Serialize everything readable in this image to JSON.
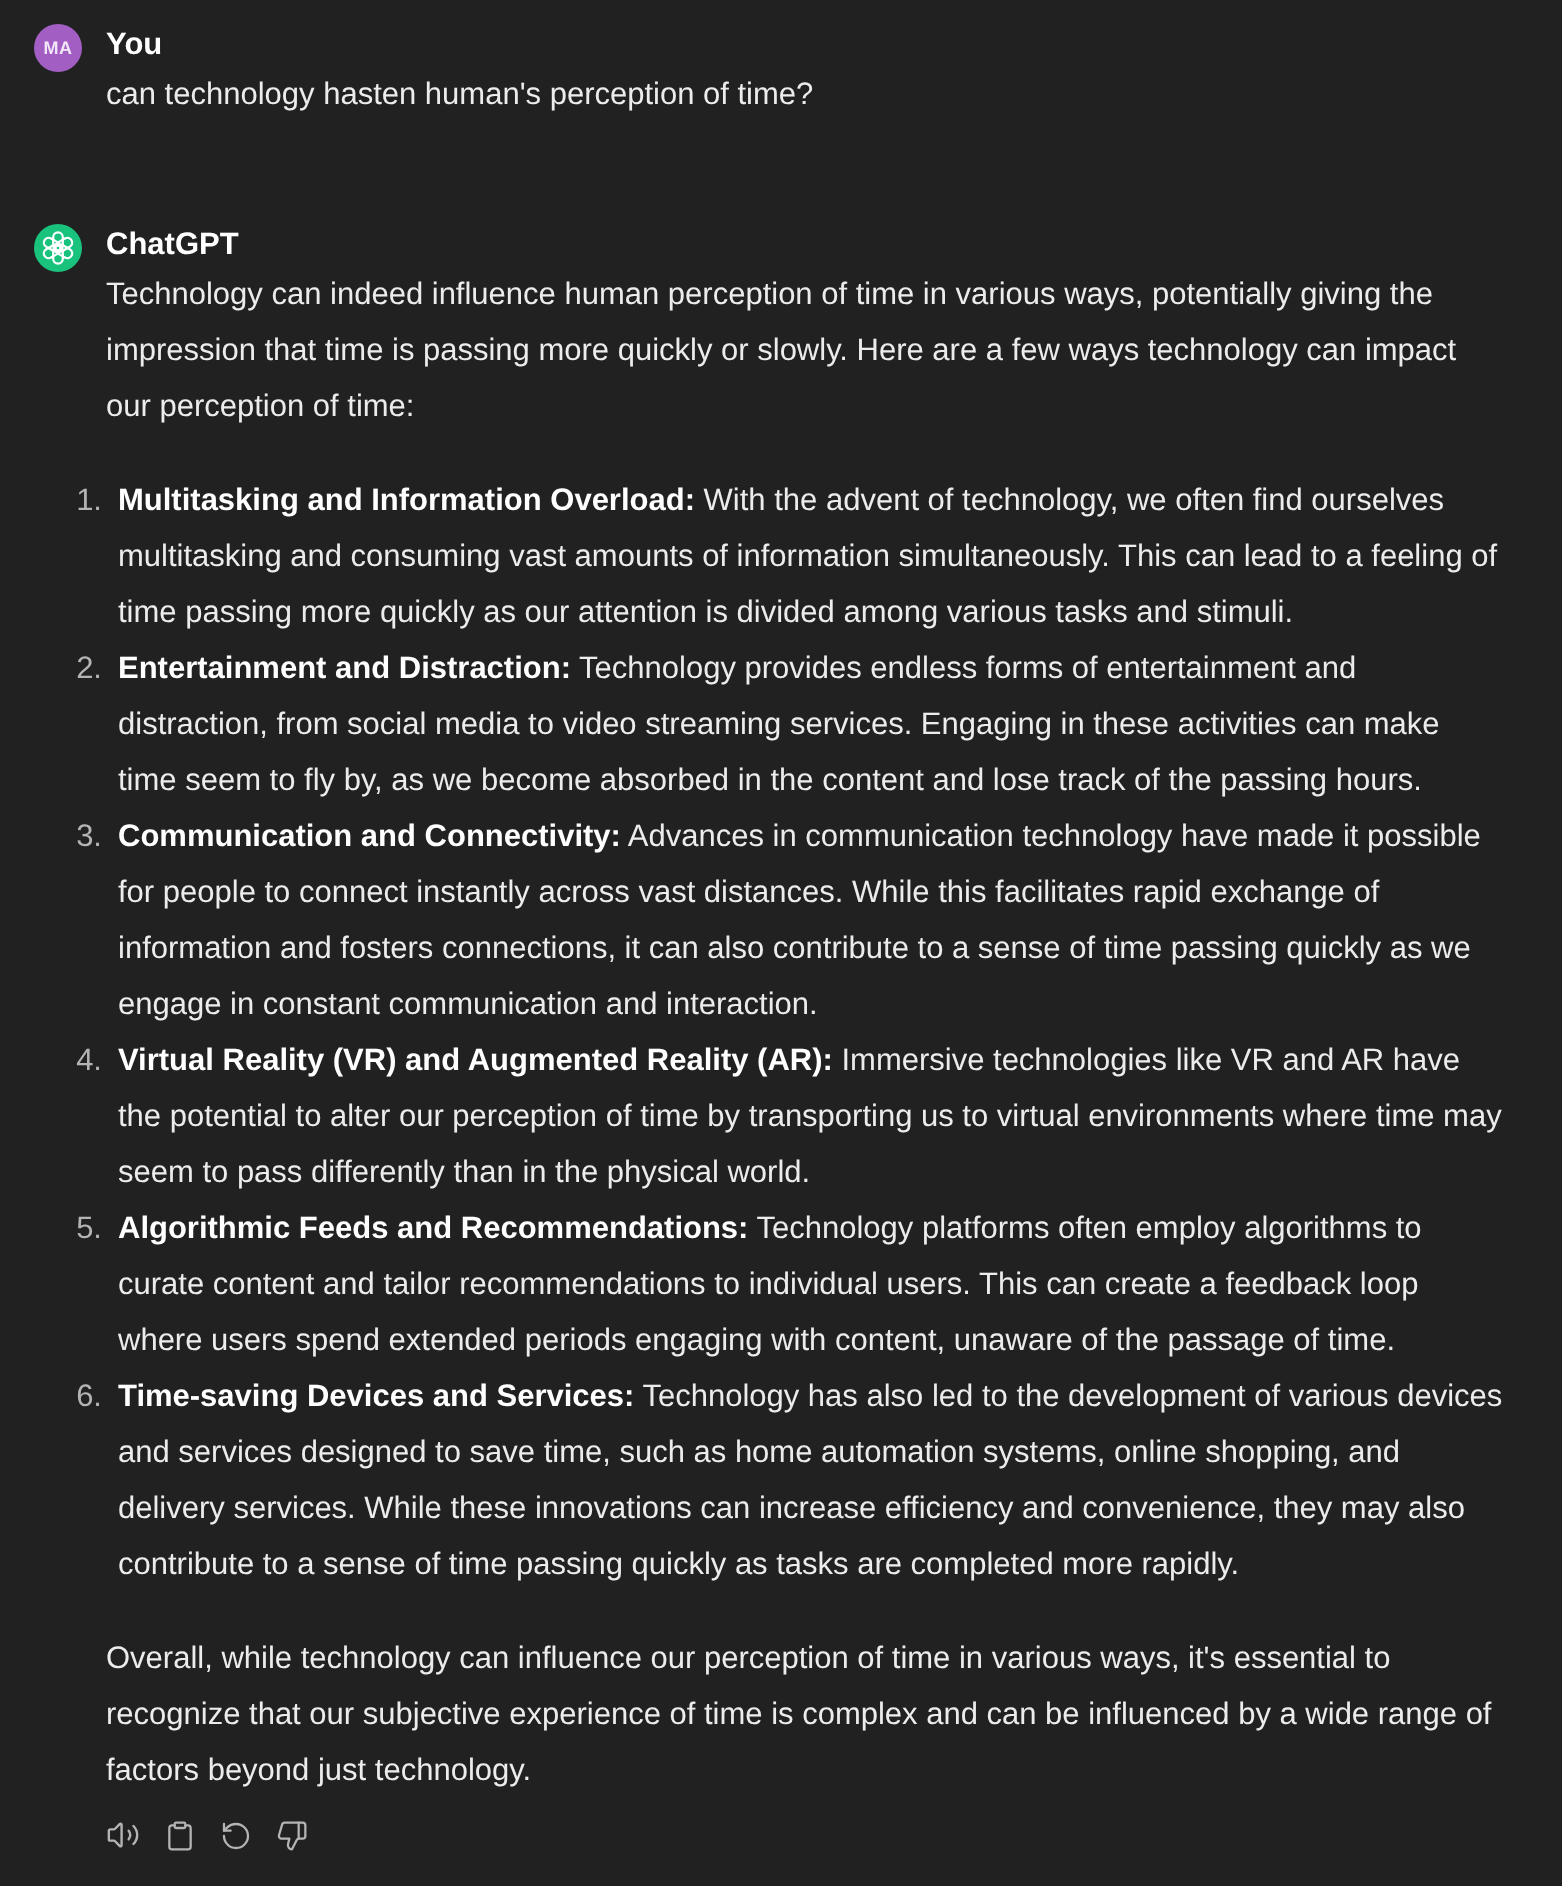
{
  "messages": [
    {
      "kind": "user",
      "author": "You",
      "avatar_initials": "MA",
      "blocks": [
        {
          "kind": "paragraph",
          "text": "can technology hasten human's perception of time?"
        }
      ]
    },
    {
      "kind": "assistant",
      "author": "ChatGPT",
      "blocks": [
        {
          "kind": "paragraph",
          "text": "Technology can indeed influence human perception of time in various ways, potentially giving the impression that time is passing more quickly or slowly. Here are a few ways technology can impact our perception of time:"
        },
        {
          "kind": "list",
          "items": [
            {
              "number": "1.",
              "text": "**Multitasking and Information Overload:** With the advent of technology, we often find ourselves multitasking and consuming vast amounts of information simultaneously. This can lead to a feeling of time passing more quickly as our attention is divided among various tasks and stimuli."
            },
            {
              "number": "2.",
              "text": "**Entertainment and Distraction:** Technology provides endless forms of entertainment and distraction, from social media to video streaming services. Engaging in these activities can make time seem to fly by, as we become absorbed in the content and lose track of the passing hours."
            },
            {
              "number": "3.",
              "text": "**Communication and Connectivity:** Advances in communication technology have made it possible for people to connect instantly across vast distances. While this facilitates rapid exchange of information and fosters connections, it can also contribute to a sense of time passing quickly as we engage in constant communication and interaction."
            },
            {
              "number": "4.",
              "text": "**Virtual Reality (VR) and Augmented Reality (AR):** Immersive technologies like VR and AR have the potential to alter our perception of time by transporting us to virtual environments where time may seem to pass differently than in the physical world."
            },
            {
              "number": "5.",
              "text": "**Algorithmic Feeds and Recommendations:** Technology platforms often employ algorithms to curate content and tailor recommendations to individual users. This can create a feedback loop where users spend extended periods engaging with content, unaware of the passage of time."
            },
            {
              "number": "6.",
              "text": "**Time-saving Devices and Services:** Technology has also led to the development of various devices and services designed to save time, such as home automation systems, online shopping, and delivery services. While these innovations can increase efficiency and convenience, they may also contribute to a sense of time passing quickly as tasks are completed more rapidly."
            }
          ]
        },
        {
          "kind": "paragraph",
          "text": "Overall, while technology can influence our perception of time in various ways, it's essential to recognize that our subjective experience of time is complex and can be influenced by a wide range of factors beyond just technology."
        }
      ]
    }
  ]
}
